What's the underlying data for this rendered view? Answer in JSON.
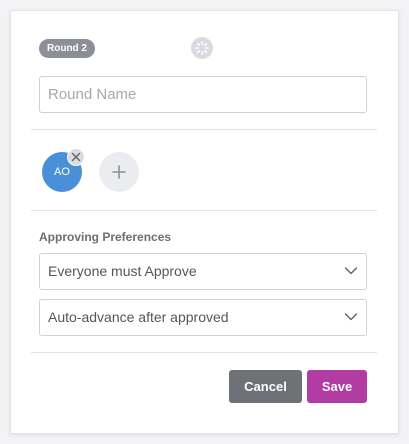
{
  "round": {
    "badge_label": "Round 2"
  },
  "round_name": {
    "placeholder": "Round Name",
    "value": ""
  },
  "approvers": [
    {
      "initials": "AO",
      "color": "#4a90d9"
    }
  ],
  "preferences": {
    "heading": "Approving Preferences",
    "approval_rule": "Everyone must Approve",
    "advance_rule": "Auto-advance after approved"
  },
  "actions": {
    "cancel_label": "Cancel",
    "save_label": "Save"
  },
  "colors": {
    "save": "#b33ba4",
    "cancel": "#6e7178",
    "avatar": "#4a90d9"
  },
  "icons": {
    "status": "loading-spinner-icon",
    "remove": "close-icon",
    "add": "plus-icon",
    "dropdown": "chevron-down-icon"
  }
}
